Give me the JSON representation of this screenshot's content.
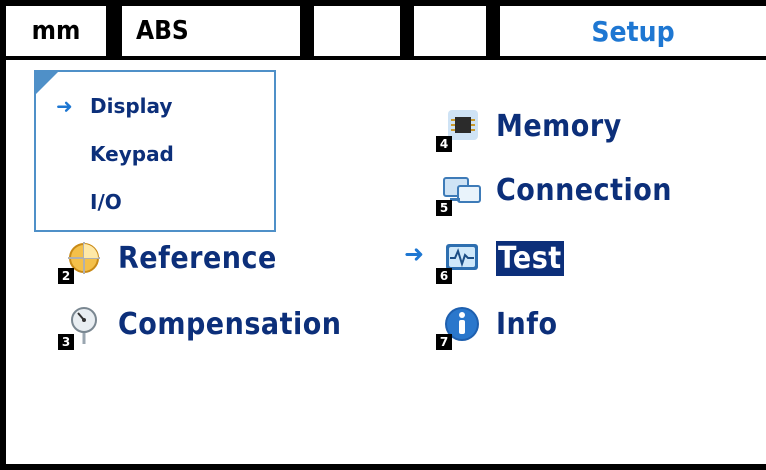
{
  "status_bar": {
    "unit": "mm",
    "mode": "ABS",
    "slot3": "",
    "slot4": "",
    "title": "Setup"
  },
  "popup_menu": {
    "items": [
      "Display",
      "Keypad",
      "I/O"
    ],
    "selected": "Display"
  },
  "menu": {
    "items": [
      {
        "num": "2",
        "label": "Reference",
        "icon": "reference-icon"
      },
      {
        "num": "3",
        "label": "Compensation",
        "icon": "compensation-icon"
      },
      {
        "num": "4",
        "label": "Memory",
        "icon": "memory-chip-icon"
      },
      {
        "num": "5",
        "label": "Connection",
        "icon": "connection-icon"
      },
      {
        "num": "6",
        "label": "Test",
        "icon": "test-icon"
      },
      {
        "num": "7",
        "label": "Info",
        "icon": "info-icon"
      }
    ],
    "selected": "Test"
  },
  "colors": {
    "text_blue": "#0c2f7a",
    "accent_blue": "#1e77d2",
    "border_blue": "#4f90c8"
  }
}
